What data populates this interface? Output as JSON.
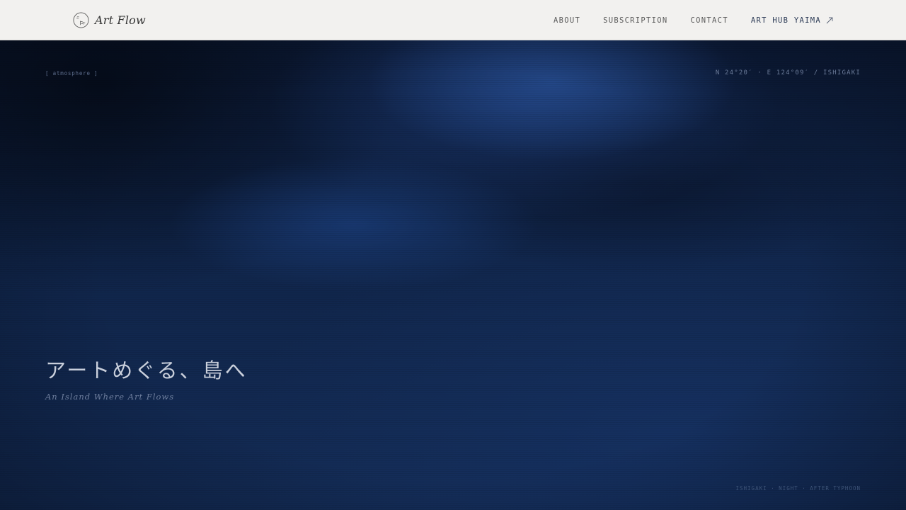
{
  "header": {
    "brand": {
      "name": "Art Flow",
      "logo_icon": "art-flow-logo-icon"
    },
    "nav": {
      "about": "ABOUT",
      "subscription": "SUBSCRIPTION",
      "contact": "CONTACT",
      "art_hub": "ART HUB YAIMA",
      "art_hub_icon": "external-arrow-icon"
    },
    "colors": {
      "background": "#f2f1ef",
      "text": "#5a5a5a",
      "accent": "#2b3a55"
    }
  },
  "hero": {
    "tag": "[ atmosphere ]",
    "coordinates": "N 24°20′ · E 124°09′ / ISHIGAKI",
    "headline": "アートめぐる、島へ",
    "subheadline": "An Island Where Art Flows",
    "caption": "ISHIGAKI · NIGHT · AFTER TYPHOON",
    "colors": {
      "deep": "#0c1a36",
      "mid": "#10254a",
      "glow": "#28509a",
      "headline": "#c9cfdb"
    }
  }
}
